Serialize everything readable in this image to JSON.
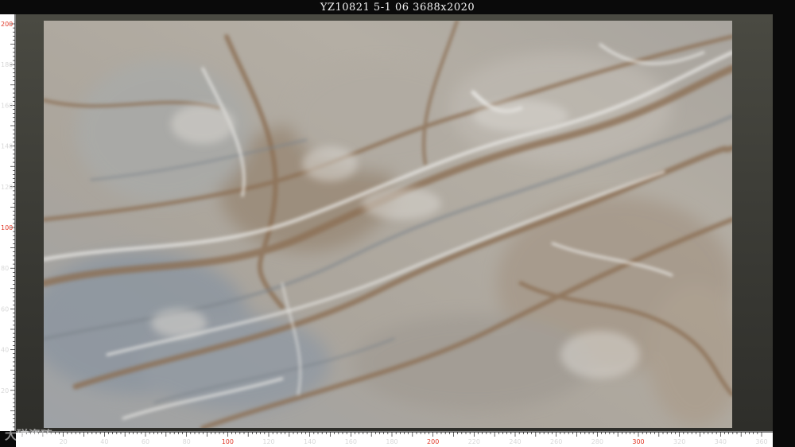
{
  "header": {
    "title": "YZ10821 5-1 06 3688x2020"
  },
  "rulers": {
    "left": [
      {
        "label": "200",
        "value": 200,
        "highlight": true
      },
      {
        "label": "180",
        "value": 180,
        "highlight": false
      },
      {
        "label": "160",
        "value": 160,
        "highlight": false
      },
      {
        "label": "140",
        "value": 140,
        "highlight": false
      },
      {
        "label": "120",
        "value": 120,
        "highlight": false
      },
      {
        "label": "100",
        "value": 100,
        "highlight": true
      },
      {
        "label": "80",
        "value": 80,
        "highlight": false
      },
      {
        "label": "60",
        "value": 60,
        "highlight": false
      },
      {
        "label": "40",
        "value": 40,
        "highlight": false
      },
      {
        "label": "20",
        "value": 20,
        "highlight": false
      }
    ],
    "bottom": [
      {
        "label": "20",
        "value": 20,
        "highlight": false
      },
      {
        "label": "40",
        "value": 40,
        "highlight": false
      },
      {
        "label": "60",
        "value": 60,
        "highlight": false
      },
      {
        "label": "80",
        "value": 80,
        "highlight": false
      },
      {
        "label": "100",
        "value": 100,
        "highlight": true
      },
      {
        "label": "120",
        "value": 120,
        "highlight": false
      },
      {
        "label": "140",
        "value": 140,
        "highlight": false
      },
      {
        "label": "160",
        "value": 160,
        "highlight": false
      },
      {
        "label": "180",
        "value": 180,
        "highlight": false
      },
      {
        "label": "200",
        "value": 200,
        "highlight": true
      },
      {
        "label": "220",
        "value": 220,
        "highlight": false
      },
      {
        "label": "240",
        "value": 240,
        "highlight": false
      },
      {
        "label": "260",
        "value": 260,
        "highlight": false
      },
      {
        "label": "280",
        "value": 280,
        "highlight": false
      },
      {
        "label": "300",
        "value": 300,
        "highlight": true
      },
      {
        "label": "320",
        "value": 320,
        "highlight": false
      },
      {
        "label": "340",
        "value": 340,
        "highlight": false
      },
      {
        "label": "360",
        "value": 360,
        "highlight": false
      }
    ]
  },
  "colors": {
    "slab_base": "#a9a7a2",
    "vein_brown": "#8c6f55",
    "vein_white": "#e6e6e4",
    "vein_gray": "#8e949a",
    "highlight_tick": "#e03a2a"
  },
  "watermark": {
    "text": "大磁瓷砖"
  }
}
